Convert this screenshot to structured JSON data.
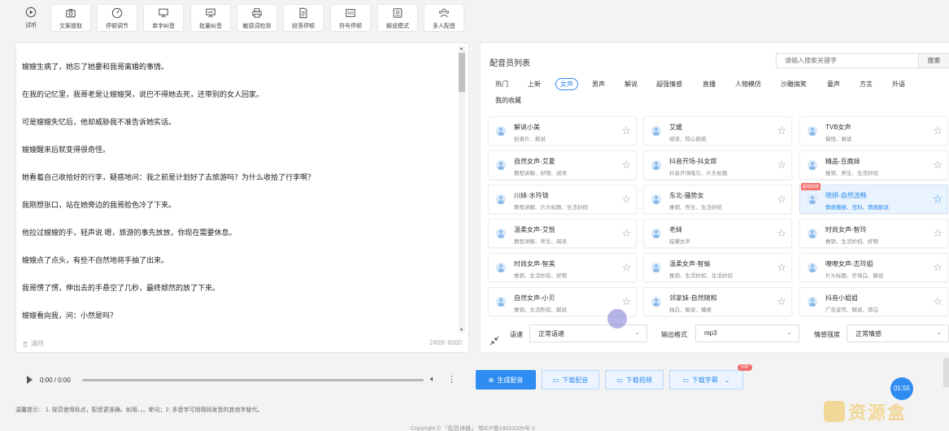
{
  "toolbar": {
    "items": [
      {
        "label": "试听",
        "icon": "play-circle-icon"
      },
      {
        "label": "文案提取",
        "icon": "camera-icon"
      },
      {
        "label": "停顿调节",
        "icon": "gauge-icon"
      },
      {
        "label": "单字纠音",
        "icon": "presentation-icon"
      },
      {
        "label": "批量纠音",
        "icon": "presentation-icon"
      },
      {
        "label": "敏感词检测",
        "icon": "printer-icon"
      },
      {
        "label": "段落停顿",
        "icon": "document-icon"
      },
      {
        "label": "符号停顿",
        "icon": "symbol-icon"
      },
      {
        "label": "解说模式",
        "icon": "narration-icon"
      },
      {
        "label": "多人配音",
        "icon": "users-icon"
      }
    ]
  },
  "editor": {
    "paragraphs": [
      "嫂嫂生病了，她忘了她要和我哥离婚的事情。",
      "在我的记忆里，我哥老是让嫂嫂哭，说巴不得她去死，还带别的女人回家。",
      "可是嫂嫂失忆后，他却威胁我不准告诉她实话。",
      "嫂嫂醒来后就变得很奇怪。",
      "她看着自己收拾好的行李，疑惑地问：我之前是计划好了去旅游吗？为什么收拾了行李啊？",
      "我刚想张口，站在她旁边的我哥脸色冷了下来。",
      "他拉过嫂嫂的手，轻声说 嗯，旅游的事先放放，你现在需要休息。",
      "嫂嫂点了点头，有些不自然地将手抽了出来。",
      "我哥愣了愣，伸出去的手悬空了几秒，最终颓然的放了下来。",
      "嫂嫂看向我，问：小然是吗？"
    ],
    "clear_label": "清除",
    "count": "2469/ 8000"
  },
  "voice_panel": {
    "title": "配音员列表",
    "search_placeholder": "请输入搜索关键字",
    "search_button": "搜索",
    "categories": [
      "热门",
      "上新",
      "女声",
      "男声",
      "解说",
      "超强情感",
      "直播",
      "人物模仿",
      "沙雕搞笑",
      "童声",
      "方言",
      "外语",
      "我的收藏"
    ],
    "active_category": "女声",
    "voices": [
      {
        "name": "解说小美",
        "tags": "纪录片、解说"
      },
      {
        "name": "艾媛",
        "tags": "阅读、知心姐姐"
      },
      {
        "name": "TVB女声",
        "tags": "搞怪、解说"
      },
      {
        "name": "自然女声-艾夏",
        "tags": "教程讲解、好物、阅读"
      },
      {
        "name": "抖音开场-抖女郎",
        "tags": "抖音开场吸引、片头标题"
      },
      {
        "name": "精品-豆腐妹",
        "tags": "推销、养生、生活妙招"
      },
      {
        "name": "川妹-水玲珑",
        "tags": "教程讲解、片头标题、生活妙招"
      },
      {
        "name": "东北-骚势女",
        "tags": "推销、养生、生活妙招"
      },
      {
        "name": "晓妍-自然流畅",
        "tags": "情感播报、百科、情感解说",
        "badge": "超强情感",
        "selected": true
      },
      {
        "name": "温柔女声-艾悦",
        "tags": "教程讲解、养生、阅读"
      },
      {
        "name": "老妹",
        "tags": "临曜女声"
      },
      {
        "name": "时尚女声-智玲",
        "tags": "推销、生活妙招、好物"
      },
      {
        "name": "时尚女声-智美",
        "tags": "推销、生活妙招、好物"
      },
      {
        "name": "温柔女声-智瑜",
        "tags": "推销、生活妙招、生活妙招"
      },
      {
        "name": "嘹嘹女声-志玲姐",
        "tags": "片头标题、开场白、解说"
      },
      {
        "name": "自然女声-小贝",
        "tags": "推销、生活秒招、解说"
      },
      {
        "name": "邻家妹-自然随和",
        "tags": "独白、解说、播报"
      },
      {
        "name": "抖音小姐姐",
        "tags": "广告宣传、解说、旁白"
      }
    ]
  },
  "settings": {
    "speed_label": "语速",
    "speed_value": "正常语速",
    "format_label": "输出格式",
    "format_value": "mp3",
    "emotion_label": "情感强度",
    "emotion_value": "正常情感"
  },
  "player": {
    "time": "0:00 / 0:00"
  },
  "actions": {
    "generate": "生成配音",
    "download_audio": "下载配音",
    "download_video": "下载视频",
    "download_subtitle": "下载字幕",
    "vip": "VIP"
  },
  "tip": "温馨提示： 1. 规范使用标点，配音更准确。如用、，、断句；2. 多音字可用相同发音的其他字替代。",
  "copyright": "Copyright © 「配音神器」 鄂ICP备19023205号-1",
  "timer": "01:55",
  "watermark": "资源盒"
}
